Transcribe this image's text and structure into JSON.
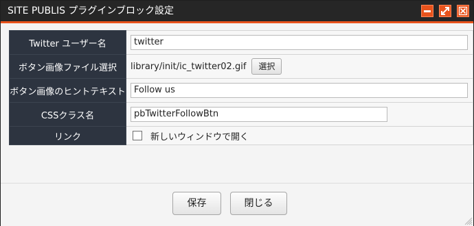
{
  "window": {
    "title": "SITE PUBLIS プラグインブロック設定",
    "accent_color": "#e8531c",
    "controls": [
      "minimize-icon",
      "maximize-icon",
      "close-icon"
    ]
  },
  "form": {
    "rows": [
      {
        "label": "Twitter ユーザー名",
        "value": "twitter"
      },
      {
        "label": "ボタン画像ファイル選択",
        "value": "library/init/ic_twitter02.gif",
        "button": "選択"
      },
      {
        "label": "ボタン画像のヒントテキスト",
        "value": "Follow us"
      },
      {
        "label": "CSSクラス名",
        "value": "pbTwitterFollowBtn"
      },
      {
        "label": "リンク",
        "checkbox_label": "新しいウィンドウで開く",
        "checked": false
      }
    ]
  },
  "footer": {
    "save_label": "保存",
    "close_label": "閉じる"
  }
}
